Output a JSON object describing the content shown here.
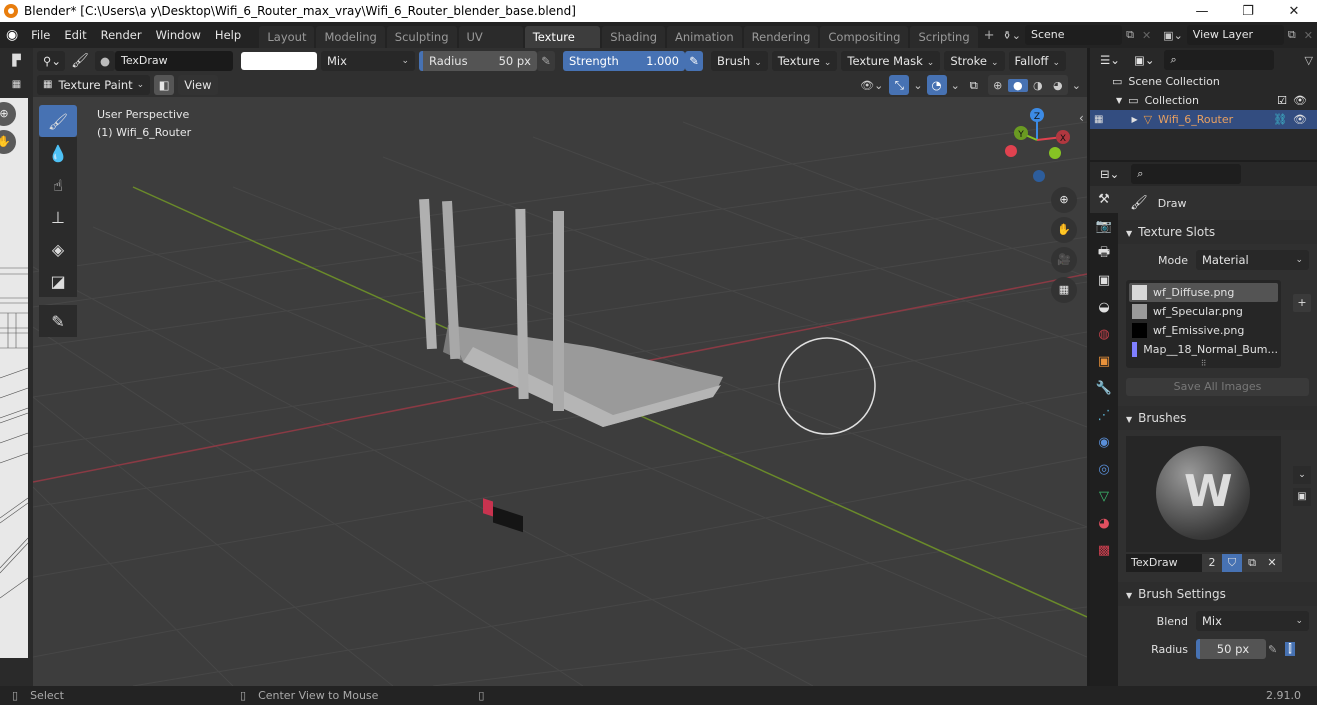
{
  "window": {
    "title": "Blender* [C:\\Users\\a y\\Desktop\\Wifi_6_Router_max_vray\\Wifi_6_Router_blender_base.blend]",
    "minimize": "—",
    "maximize": "❐",
    "close": "✕"
  },
  "menu": [
    "File",
    "Edit",
    "Render",
    "Window",
    "Help"
  ],
  "workspaces": [
    "Layout",
    "Modeling",
    "Sculpting",
    "UV Editing",
    "Texture Paint",
    "Shading",
    "Animation",
    "Rendering",
    "Compositing",
    "Scripting"
  ],
  "active_workspace": "Texture Paint",
  "add_workspace": "+",
  "scene": {
    "name": "Scene"
  },
  "view_layer": {
    "name": "View Layer"
  },
  "tool_header": {
    "brush_name": "TexDraw",
    "color_hex": "#ffffff",
    "blend_mode": "Mix",
    "radius_label": "Radius",
    "radius_value": "50 px",
    "strength_label": "Strength",
    "strength_value": "1.000",
    "menus": [
      "Brush",
      "Texture",
      "Texture Mask",
      "Stroke",
      "Falloff"
    ]
  },
  "view_header": {
    "mode": "Texture Paint",
    "view_menu": "View"
  },
  "viewport": {
    "perspective": "User Perspective",
    "object": "(1) Wifi_6_Router",
    "gizmo_axes": [
      "X",
      "Y",
      "Z"
    ],
    "colors": {
      "x_axis": "#e0424f",
      "y_axis": "#86c324",
      "z_axis": "#3c8be5"
    }
  },
  "toolbar": [
    "draw-brush",
    "soften-brush",
    "smear-brush",
    "clone-brush",
    "fill-brush",
    "mask-brush",
    "annotate"
  ],
  "outliner": {
    "scene_collection": "Scene Collection",
    "collection": "Collection",
    "object": "Wifi_6_Router"
  },
  "properties": {
    "active_tool": "Draw",
    "texture_slots": {
      "title": "Texture Slots",
      "mode_label": "Mode",
      "mode_value": "Material",
      "slots": [
        {
          "name": "wf_Diffuse.png",
          "swatch": "#d8d8d8",
          "selected": true
        },
        {
          "name": "wf_Specular.png",
          "swatch": "#9a9a9a",
          "selected": false
        },
        {
          "name": "wf_Emissive.png",
          "swatch": "#000000",
          "selected": false
        },
        {
          "name": "Map__18_Normal_Bum...",
          "swatch": "#7f7fff",
          "selected": false
        }
      ],
      "save_all": "Save All Images"
    },
    "brushes": {
      "title": "Brushes",
      "brush_name": "TexDraw",
      "users": "2"
    },
    "brush_settings": {
      "title": "Brush Settings",
      "blend_label": "Blend",
      "blend_value": "Mix",
      "radius_label": "Radius",
      "radius_value": "50 px"
    }
  },
  "status": {
    "left": "Select",
    "middle": "Center View to Mouse",
    "version": "2.91.0"
  }
}
